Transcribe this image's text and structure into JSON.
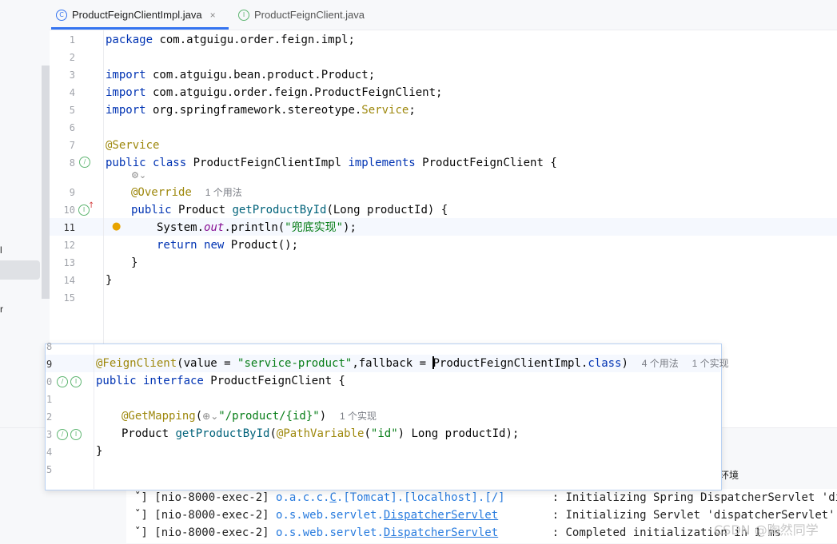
{
  "tabs": [
    {
      "label": "ProductFeignClientImpl.java",
      "icon": "class-icon",
      "active": true,
      "close": "×"
    },
    {
      "label": "ProductFeignClient.java",
      "icon": "interface-icon",
      "active": false
    }
  ],
  "left_panel": {
    "frag1": "l",
    "frag2": "r"
  },
  "editor": {
    "line_numbers": [
      "1",
      "2",
      "3",
      "4",
      "5",
      "6",
      "7",
      "8",
      "9",
      "10",
      "11",
      "12",
      "13",
      "14",
      "15"
    ],
    "lines": {
      "l1_kw": "package",
      "l1_rest": " com.atguigu.order.feign.impl;",
      "l3_kw": "import",
      "l3_rest": " com.atguigu.bean.product.Product;",
      "l4_kw": "import",
      "l4_rest": " com.atguigu.order.feign.ProductFeignClient;",
      "l5_kw": "import",
      "l5_rest": " org.springframework.stereotype.",
      "l5_ann": "Service",
      "l5_end": ";",
      "l7_ann": "@Service",
      "l8_kw1": "public class",
      "l8_name": " ProductFeignClientImpl ",
      "l8_kw2": "implements",
      "l8_rest": " ProductFeignClient {",
      "l9_ann": "@Override",
      "l9_hint": "1 个用法",
      "l10_kw": "public",
      "l10_a": " Product ",
      "l10_meth": "getProductById",
      "l10_rest": "(Long productId) {",
      "l11_a": "System.",
      "l11_out": "out",
      "l11_b": ".println(",
      "l11_str": "\"兜底实现\"",
      "l11_c": ");",
      "l12_kw1": "return",
      "l12_kw2": "new",
      "l12_rest": " Product();",
      "l13": "}",
      "l14": "}"
    },
    "current_line": "11"
  },
  "popup": {
    "line_numbers": [
      "8",
      "9",
      "0",
      "1",
      "2",
      "3",
      "4",
      "5"
    ],
    "line9": {
      "ann": "@FeignClient",
      "a": "(value = ",
      "str": "\"service-product\"",
      "b": ",fallback = ",
      "cls": "ProductFeignClientImpl",
      "dot": ".",
      "kw": "class",
      "c": ")",
      "hint1": "4 个用法",
      "hint2": "1 个实现"
    },
    "line10": {
      "kw": "public interface",
      "rest": " ProductFeignClient {"
    },
    "line12": {
      "ann": "@GetMapping",
      "a": "(",
      "str": "\"/product/{id}\"",
      "b": ")",
      "hint": "1 个实现"
    },
    "line13": {
      "a": "Product ",
      "meth": "getProductById",
      "b": "(",
      "ann": "@PathVariable",
      "c": "(",
      "str": "\"id\"",
      "d": ") Long productId);"
    },
    "line14": "}"
  },
  "console": {
    "env_label": "环境",
    "lines": [
      {
        "thread": "ˇ] [nio-8000-exec-2] ",
        "logger_a": "o.a.c.c.",
        "logger_u": "C",
        "logger_b": ".[Tomcat].[localhost].[/]",
        "pad": "       ",
        "msg": ": Initializing Spring DispatcherServlet 'dispatc"
      },
      {
        "thread": "ˇ] [nio-8000-exec-2] ",
        "logger_a": "o.s.web.servlet.",
        "logger_u": "DispatcherServlet",
        "logger_b": "",
        "pad": "        ",
        "msg": ": Initializing Servlet 'dispatcherServlet'"
      },
      {
        "thread": "ˇ] [nio-8000-exec-2] ",
        "logger_a": "o.s.web.servlet.",
        "logger_u": "DispatcherServlet",
        "logger_b": "",
        "pad": "        ",
        "msg": ": Completed initialization in 1 ms"
      }
    ]
  },
  "watermark": "CSDN @陶然同学",
  "colors": {
    "accent": "#3574f0",
    "keyword": "#0033b3",
    "annotation": "#9e880d",
    "string": "#067d17",
    "method": "#00627a"
  }
}
